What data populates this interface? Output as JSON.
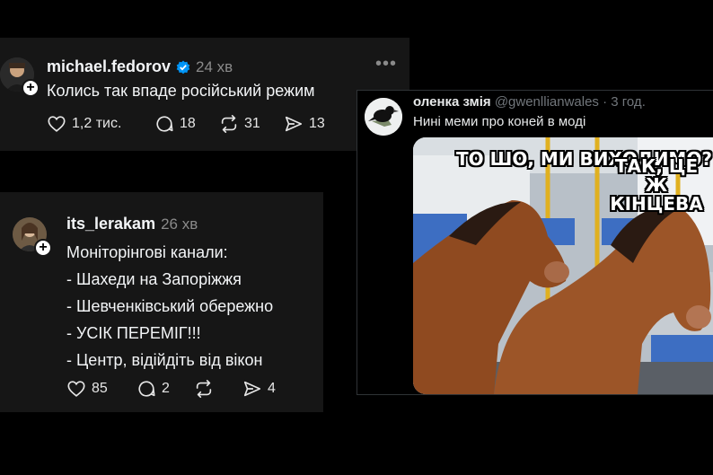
{
  "posts": [
    {
      "username": "michael.fedorov",
      "verified": true,
      "time": "24 хв",
      "lines": [
        "Колись так впаде російський режим"
      ],
      "stats": {
        "likes": "1,2 тис.",
        "replies": "18",
        "reposts": "31",
        "shares": "13"
      }
    },
    {
      "username": "its_lerakam",
      "verified": false,
      "time": "26 хв",
      "lines": [
        "Моніторінгові канали:",
        "- Шахеди на Запоріжжя",
        "- Шевченківський обережно",
        "- УСІК ПЕРЕМІГ!!!",
        "- Центр, відійдіть від вікон"
      ],
      "stats": {
        "likes": "85",
        "replies": "2",
        "reposts": "",
        "shares": "4"
      }
    }
  ],
  "tweet": {
    "name": "оленка змія",
    "handle": "@gwenllianwales",
    "time": "· 3 год.",
    "text": "Нині меми про коней в моді",
    "meme": {
      "caption_left": "ТО ШО, МИ ВИХОДИМО?",
      "caption_right": "ТАК, ЦЕ Ж КІНЦЕВА"
    }
  },
  "icons": {
    "more": "more-dots-icon",
    "like": "heart-icon",
    "reply": "comment-icon",
    "repost": "repost-icon",
    "share": "share-icon",
    "verified": "verified-badge-icon"
  },
  "colors": {
    "background": "#000000",
    "card": "#161616",
    "verified": "#0095f6",
    "muted": "#8a8a8a"
  }
}
